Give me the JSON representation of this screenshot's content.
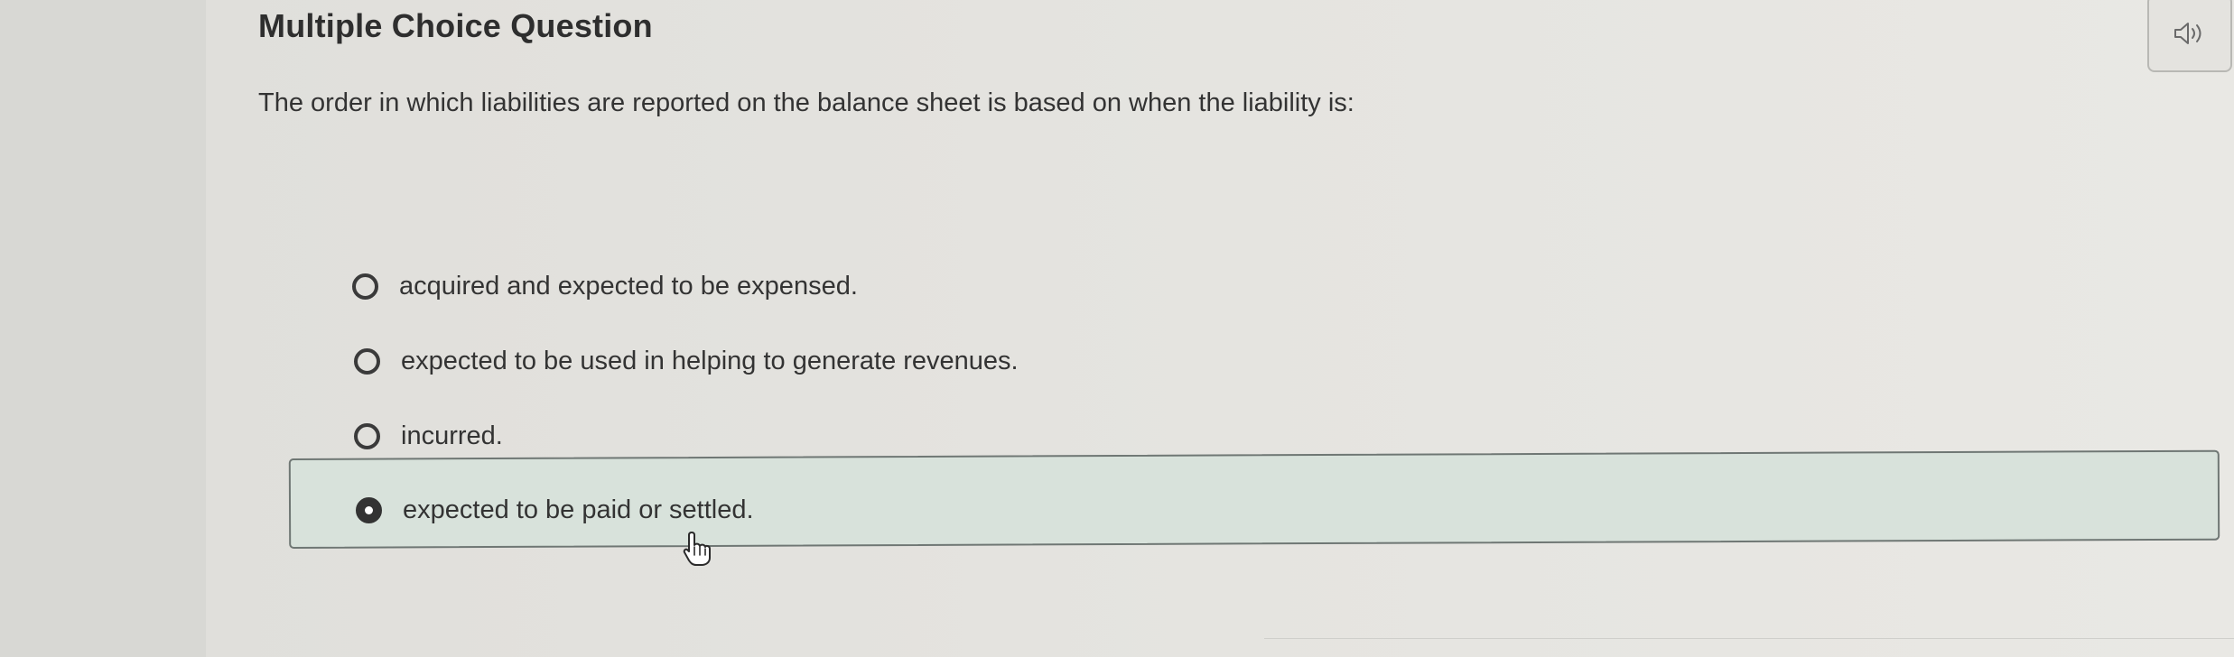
{
  "question": {
    "heading": "Multiple Choice Question",
    "prompt": "The order in which liabilities are reported on the balance sheet is based on when the liability is:"
  },
  "audio_button": {
    "icon": "speaker-icon"
  },
  "options": [
    {
      "label": "acquired and expected to be expensed.",
      "selected": false
    },
    {
      "label": "expected to be used in helping to generate revenues.",
      "selected": false
    },
    {
      "label": "incurred.",
      "selected": false
    },
    {
      "label": "expected to be paid or settled.",
      "selected": true
    }
  ],
  "colors": {
    "selected_background": "#d8e2db",
    "text": "#333333",
    "radio": "#3a3a3a"
  }
}
